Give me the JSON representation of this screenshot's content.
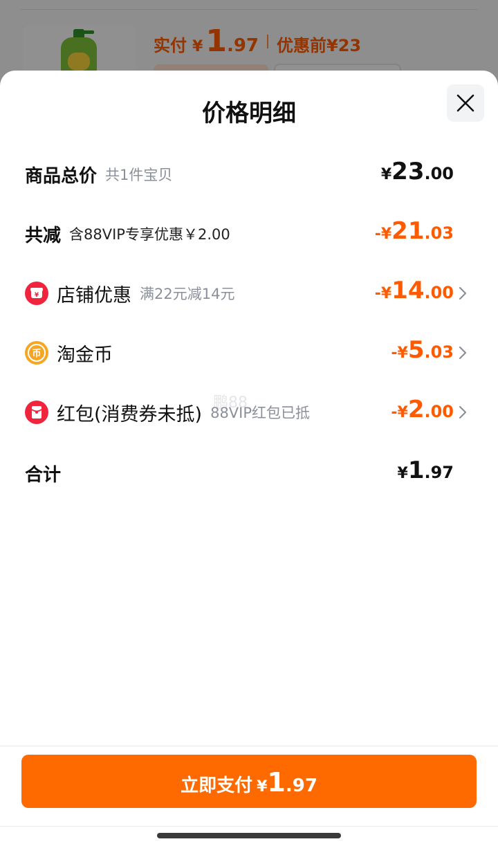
{
  "background": {
    "paid_label": "实付",
    "paid_currency": "¥",
    "paid_integer": "1",
    "paid_decimal": ".97",
    "before_label": "优惠前",
    "before_price": "¥23"
  },
  "sheet": {
    "title": "价格明细",
    "close_icon": "close-icon"
  },
  "rows": {
    "total": {
      "label": "商品总价",
      "sub": "共1件宝贝",
      "currency": "¥",
      "integer": "23",
      "decimal": ".00"
    },
    "reduction": {
      "label": "共减",
      "sub": "含88VIP专享优惠￥2.00",
      "minus": "-",
      "currency": "¥",
      "integer": "21",
      "decimal": ".03"
    },
    "store": {
      "icon": "store-discount-icon",
      "label": "店铺优惠",
      "sub": "满22元减14元",
      "minus": "-",
      "currency": "¥",
      "integer": "14",
      "decimal": ".00"
    },
    "coins": {
      "icon": "taojinbi-coin-icon",
      "label": "淘金币",
      "minus": "-",
      "currency": "¥",
      "integer": "5",
      "decimal": ".03"
    },
    "redpacket": {
      "icon": "red-packet-icon",
      "label": "红包(消费券未抵)",
      "sub": "88VIP红包已抵",
      "minus": "-",
      "currency": "¥",
      "integer": "2",
      "decimal": ".00"
    },
    "sum": {
      "label": "合计",
      "currency": "¥",
      "integer": "1",
      "decimal": ".97"
    }
  },
  "watermark": "鹏88",
  "pay_button": {
    "label": "立即支付",
    "currency": "¥",
    "integer": "1",
    "decimal": ".97"
  },
  "colors": {
    "accent": "#ff6a00",
    "price_orange": "#ff5a00",
    "red_icon": "#f0243c",
    "gold_icon": "#f5a623"
  }
}
